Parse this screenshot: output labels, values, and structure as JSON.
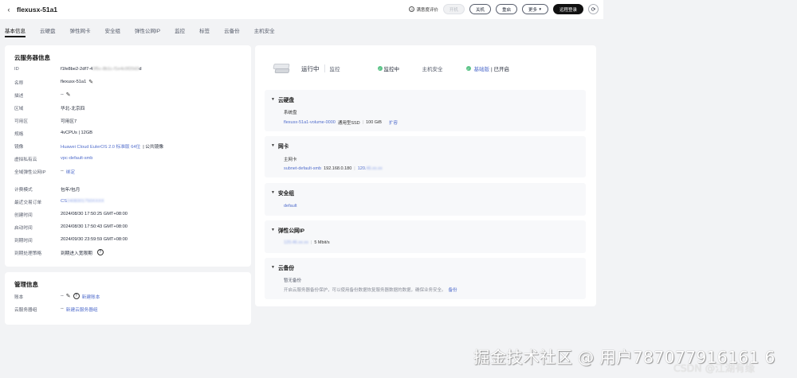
{
  "header": {
    "back_icon": "arrow-left-icon",
    "title": "flexusx-51a1",
    "survey_label": "满意度评价",
    "btn_disabled": "开机",
    "btn_shutdown": "关机",
    "btn_restart": "重启",
    "btn_more": "更多",
    "btn_login": "远程登录",
    "refresh_icon": "refresh-icon"
  },
  "tabs": [
    "基本信息",
    "云硬盘",
    "弹性网卡",
    "安全组",
    "弹性公网IP",
    "监控",
    "标签",
    "云备份",
    "主机安全"
  ],
  "info": {
    "section_title": "云服务器信息",
    "rows": [
      {
        "k": "ID",
        "v": "f1fe8be2-2df7-4",
        "v_blur": "0f5c-8b1c-f1e4c0f20d3",
        "v_tail": "d"
      },
      {
        "k": "名称",
        "v": "flexusx-51a1"
      },
      {
        "k": "描述",
        "v": "--"
      },
      {
        "k": "区域",
        "v": "华北-北京四"
      },
      {
        "k": "可用区",
        "v": "可用区7"
      },
      {
        "k": "规格",
        "v": "4vCPUs | 12GB"
      },
      {
        "k": "镜像",
        "v": "Huawei Cloud EulerOS 2.0 标准版 64位",
        "v_tail": "| 公共镜像"
      },
      {
        "k": "虚拟私有云",
        "v": "vpc-default-smb"
      },
      {
        "k": "全域弹性公网IP",
        "v": "--",
        "v_link": "绑定"
      }
    ],
    "billing_rows": [
      {
        "k": "计费模式",
        "v": "包年/包月"
      },
      {
        "k": "最近交易订单",
        "v": "CS",
        "v_blur": "2408301750XXXX"
      },
      {
        "k": "创建时间",
        "v": "2024/08/30 17:50:25 GMT+08:00"
      },
      {
        "k": "启动时间",
        "v": "2024/08/30 17:50:43 GMT+08:00"
      },
      {
        "k": "到期时间",
        "v": "2024/09/30 23:59:59 GMT+08:00"
      },
      {
        "k": "到期处理策略",
        "v": "到期进入宽限期"
      }
    ]
  },
  "mgmt": {
    "section_title": "管理信息",
    "rows": [
      {
        "k": "账本",
        "v": "--",
        "v_link": "新建账本"
      },
      {
        "k": "云服务器组",
        "v": "--",
        "v_link": "新建云服务器组"
      }
    ]
  },
  "status": {
    "state": "运行中",
    "monitor_label": "监控",
    "monitor_value": "监控中",
    "hss_label": "主机安全",
    "hss_value": "基础版",
    "hss_tail": "| 已开启"
  },
  "cards": {
    "disk": {
      "title": "云硬盘",
      "sub": "系统盘",
      "name": "flexusx-51a1-volume-0000",
      "type": "通用型SSD",
      "size": "100 GiB",
      "action": "扩容"
    },
    "nic": {
      "title": "网卡",
      "sub": "主网卡",
      "subnet": "subnet-default-smb",
      "ip": "192.168.0.180",
      "ip2": "120.",
      "ip2_blur": "46.xx.xx"
    },
    "sg": {
      "title": "安全组",
      "name": "default"
    },
    "eip": {
      "title": "弹性公网IP",
      "ip_blur": "120.46.xx.xx",
      "bandwidth": "5 Mbit/s"
    },
    "backup": {
      "title": "云备份",
      "sub": "暂无备份",
      "desc": "开启云服务器备份保护，可以使用备份数据恢复服务器数据的数据，确保业务安全。",
      "action": "备份"
    }
  },
  "watermark": {
    "main": "掘金技术社区 @ 用户787077916161 6",
    "csdn": "CSDN @江湖有缘"
  }
}
